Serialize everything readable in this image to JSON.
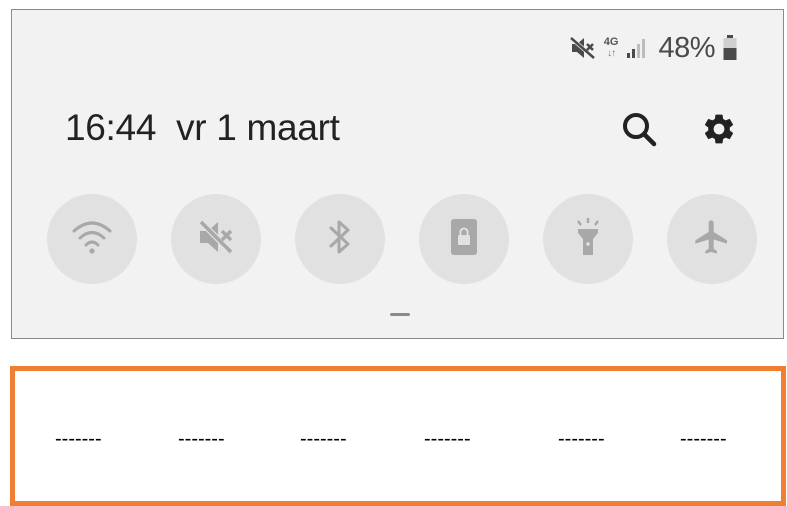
{
  "status_bar": {
    "mute_icon": "volume-off-icon",
    "network_type": "4G",
    "network_arrows": "↓↑",
    "signal_icon": "signal-bars-icon",
    "battery_percent": "48%",
    "battery_icon": "battery-icon"
  },
  "header": {
    "time": "16:44",
    "date": "vr 1 maart",
    "search_icon": "search-icon",
    "settings_icon": "gear-icon"
  },
  "quick_settings": [
    {
      "icon": "wifi-icon"
    },
    {
      "icon": "volume-off-icon"
    },
    {
      "icon": "bluetooth-icon"
    },
    {
      "icon": "screen-rotation-lock-icon"
    },
    {
      "icon": "flashlight-icon"
    },
    {
      "icon": "airplane-icon"
    }
  ],
  "placeholder_row": {
    "labels": [
      "-------",
      "-------",
      "-------",
      "-------",
      "-------",
      "-------"
    ]
  },
  "colors": {
    "panel_bg": "#f2f2f2",
    "tile_bg": "#e1e1e1",
    "icon_inactive": "#a8a8a8",
    "accent_border": "#ee7f33"
  }
}
